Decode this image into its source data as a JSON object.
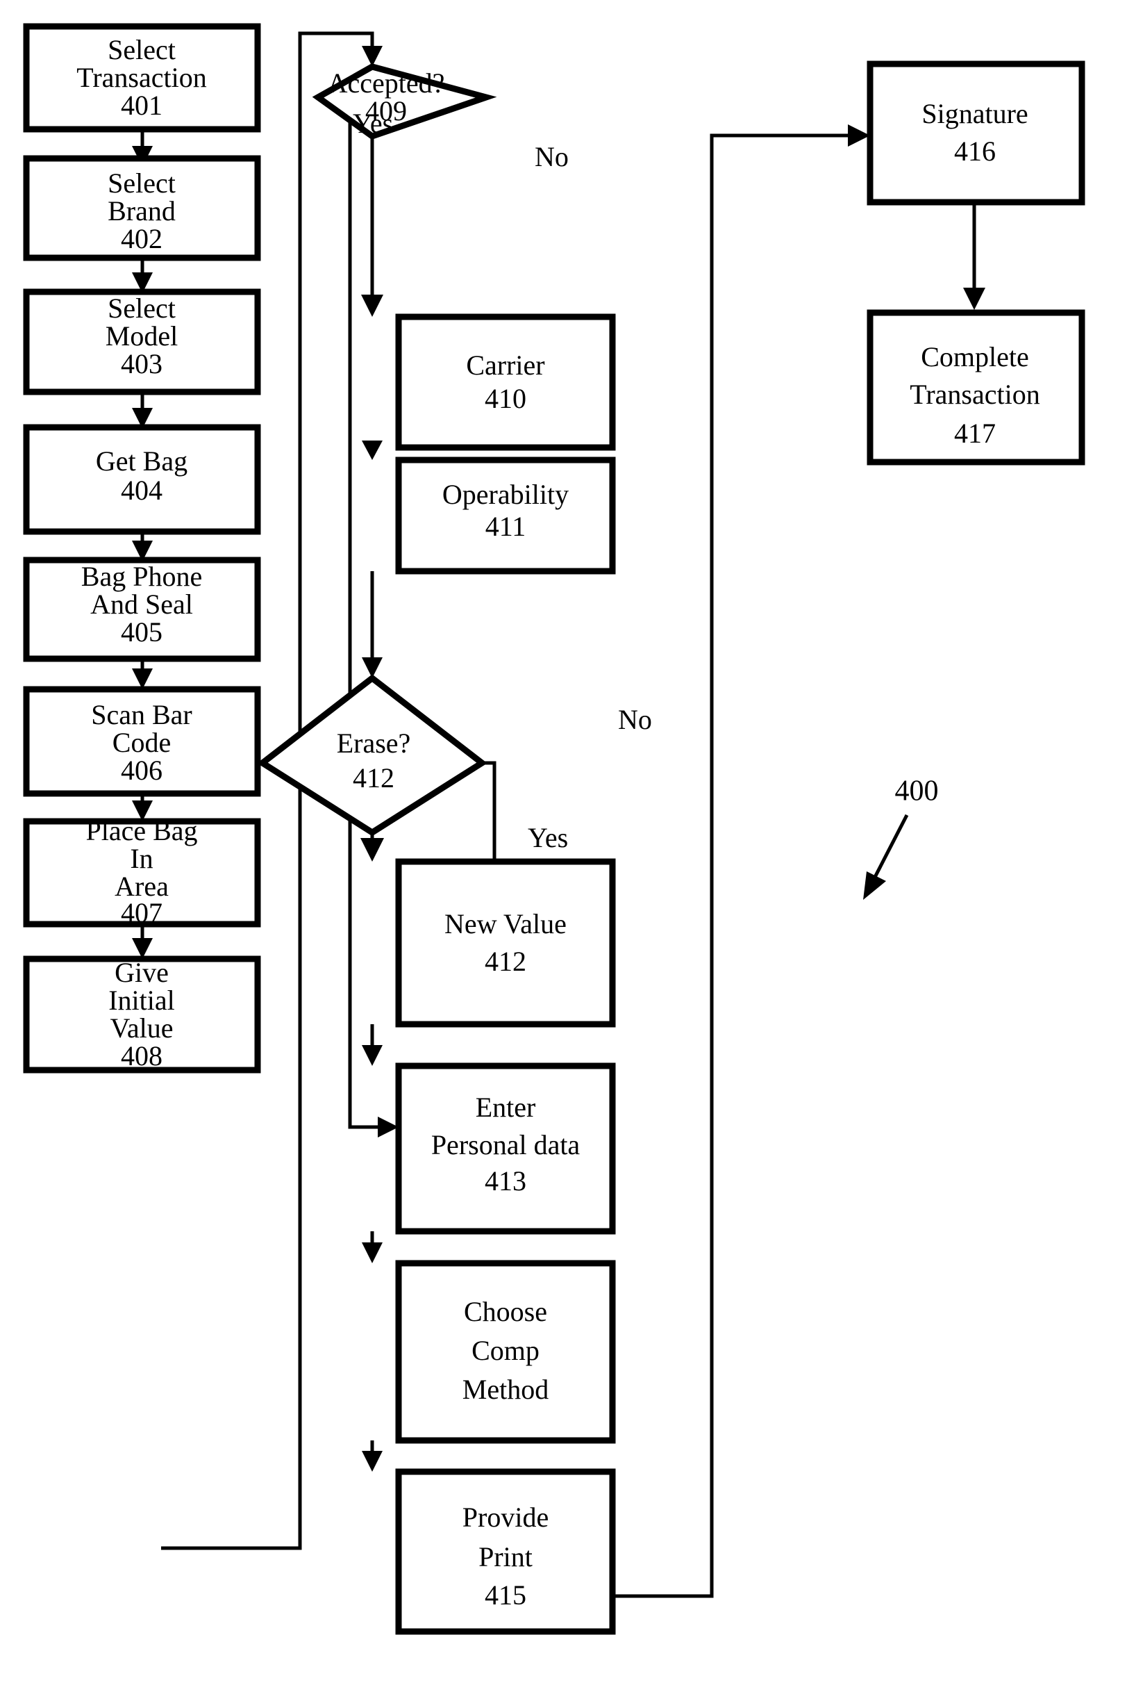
{
  "figure": {
    "reference_numeral": "400",
    "type": "flowchart"
  },
  "nodes": {
    "n401": {
      "lines": [
        "Select",
        "Transaction",
        "401"
      ]
    },
    "n402": {
      "lines": [
        "Select",
        "Brand",
        "402"
      ]
    },
    "n403": {
      "lines": [
        "Select",
        "Model",
        "403"
      ]
    },
    "n404": {
      "lines": [
        "Get Bag",
        "404"
      ]
    },
    "n405": {
      "lines": [
        "Bag Phone",
        "And Seal",
        "405"
      ]
    },
    "n406": {
      "lines": [
        "Scan Bar",
        "Code",
        "406"
      ]
    },
    "n407": {
      "lines": [
        "Place Bag",
        "In",
        "Area",
        "407"
      ]
    },
    "n408": {
      "lines": [
        "Give",
        "Initial",
        "Value",
        "408"
      ]
    },
    "n409": {
      "lines": [
        "Accepted?",
        "409"
      ]
    },
    "n410": {
      "lines": [
        "Carrier",
        "410"
      ]
    },
    "n411": {
      "lines": [
        "Operability",
        "411"
      ]
    },
    "n412d": {
      "lines": [
        "Erase?",
        "412"
      ]
    },
    "n412b": {
      "lines": [
        "New Value",
        "412"
      ]
    },
    "n413": {
      "lines": [
        "Enter",
        "Personal data",
        "413"
      ]
    },
    "n414": {
      "lines": [
        "Choose",
        "Comp",
        "Method"
      ]
    },
    "n415": {
      "lines": [
        "Provide",
        "Print",
        "415"
      ]
    },
    "n416": {
      "lines": [
        "Signature",
        "416"
      ]
    },
    "n417": {
      "lines": [
        "Complete",
        "Transaction",
        "417"
      ]
    }
  },
  "edge_labels": {
    "accepted_yes": "Yes",
    "accepted_no": "No",
    "erase_no": "No",
    "erase_yes": "Yes"
  },
  "colors": {
    "stroke": "#000000",
    "fill": "#ffffff"
  }
}
